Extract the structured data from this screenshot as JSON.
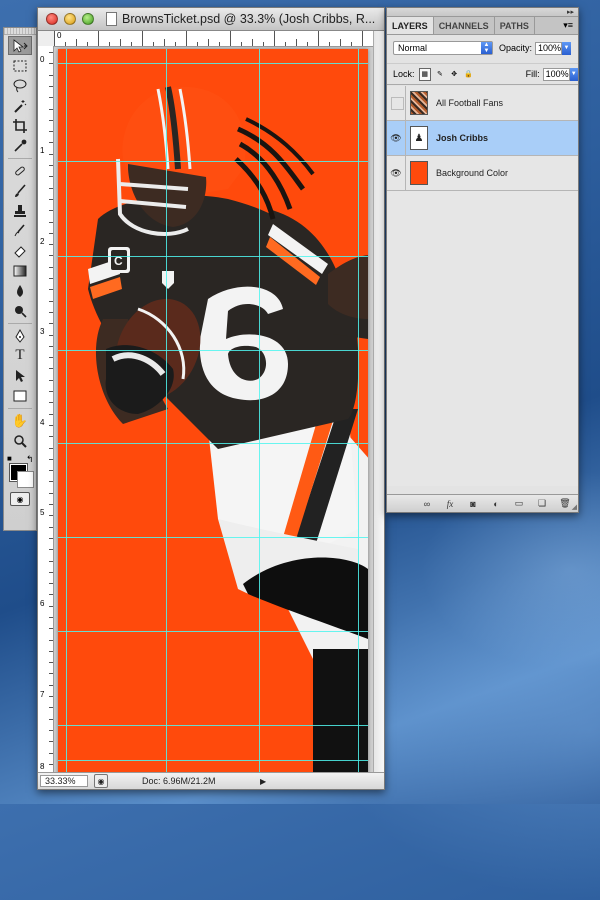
{
  "app": "Photoshop",
  "document": {
    "title": "BrownsTicket.psd @ 33.3% (Josh Cribbs, R...",
    "canvas_color": "#ff4a0c",
    "guide_color": "#4ff4ef",
    "ruler_top_labels": [
      "0"
    ],
    "ruler_left_labels": [
      "0",
      "1",
      "2",
      "3",
      "4",
      "5",
      "6",
      "7",
      "8"
    ]
  },
  "status": {
    "zoom": "33.33%",
    "doc_info": "Doc: 6.96M/21.2M"
  },
  "toolbox": {
    "tools": [
      "move-tool",
      "marquee-tool",
      "lasso-tool",
      "magic-wand-tool",
      "crop-tool",
      "eyedropper-tool",
      "healing-brush-tool",
      "brush-tool",
      "clone-stamp-tool",
      "history-brush-tool",
      "eraser-tool",
      "gradient-tool",
      "blur-tool",
      "dodge-tool",
      "pen-tool",
      "type-tool",
      "path-selection-tool",
      "shape-tool",
      "hand-tool",
      "zoom-tool"
    ],
    "foreground_color": "#000000",
    "background_color": "#ffffff"
  },
  "layers_panel": {
    "tabs": [
      "LAYERS",
      "CHANNELS",
      "PATHS"
    ],
    "active_tab": "LAYERS",
    "blend_mode": "Normal",
    "opacity_label": "Opacity:",
    "opacity_value": "100%",
    "lock_label": "Lock:",
    "fill_label": "Fill:",
    "fill_value": "100%",
    "layers": [
      {
        "name": "All Football Fans",
        "visible": false,
        "selected": false
      },
      {
        "name": "Josh Cribbs",
        "visible": true,
        "selected": true
      },
      {
        "name": "Background Color",
        "visible": true,
        "selected": false
      }
    ]
  }
}
